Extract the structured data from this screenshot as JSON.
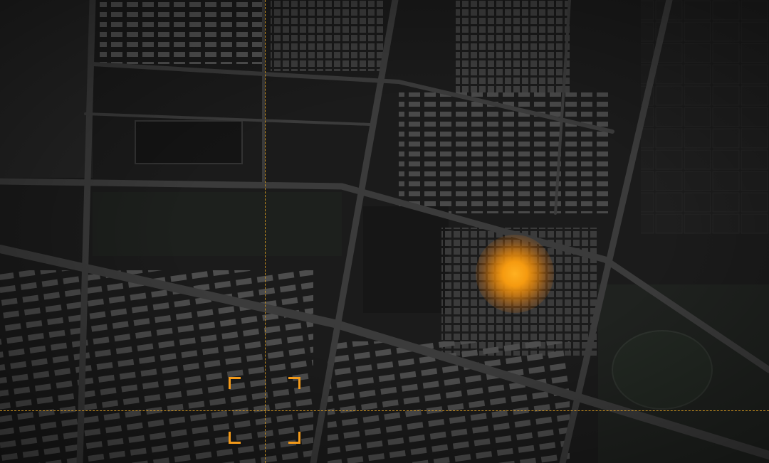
{
  "map": {
    "style": "dark satellite imagery",
    "colors": {
      "background": "#1a1a1a",
      "road": "#3a3a3a",
      "block": "#2b2b2b",
      "building": "#4a4a4a",
      "green": "#1f241f",
      "accent": "#f39a1a"
    }
  },
  "crosshair": {
    "color": "#e0a020",
    "style": "dashed"
  },
  "reticle": {
    "color": "#f39a1a",
    "shape": "corner-brackets"
  },
  "hotspot": {
    "color": "#f59a10",
    "type": "glowing-marker"
  }
}
